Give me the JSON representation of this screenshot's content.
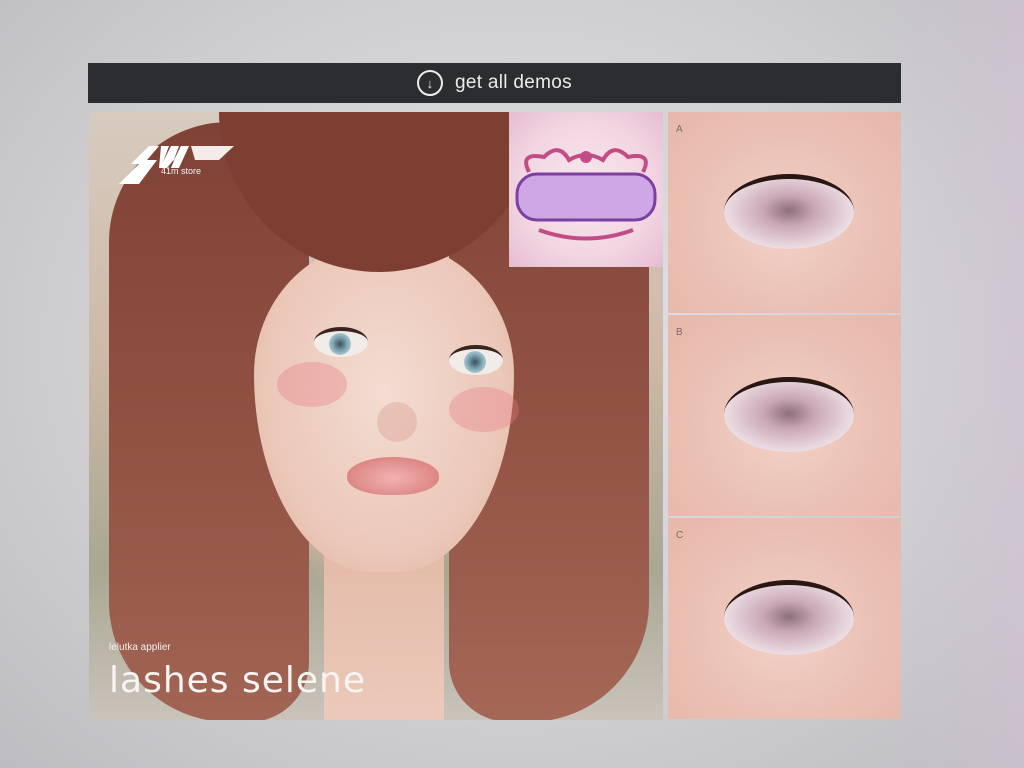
{
  "demo_bar": {
    "label": "get all demos",
    "icon": "download-icon"
  },
  "main_ad": {
    "store_name": "41m store",
    "applier": "lelutka applier",
    "product_title": "lashes selene"
  },
  "variants": [
    "A",
    "B",
    "C"
  ],
  "colors": {
    "bar_bg": "#2c2d30",
    "bar_text": "#ececec"
  }
}
